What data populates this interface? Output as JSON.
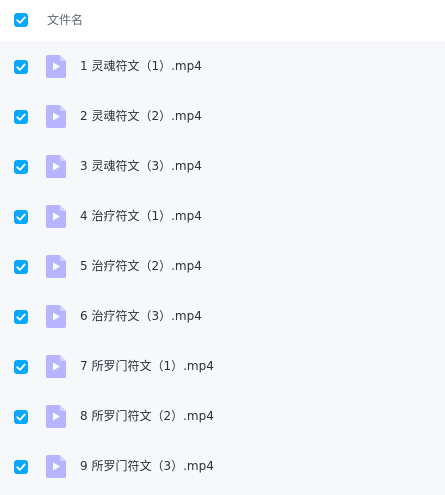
{
  "header": {
    "label": "文件名",
    "checked": true
  },
  "colors": {
    "checkbox": "#06a7ff",
    "video_icon_light": "#b8b4ff",
    "video_icon_dark": "#7c6cf5"
  },
  "files": [
    {
      "name": "1 灵魂符文（1）.mp4",
      "icon": "video-file-icon",
      "checked": true
    },
    {
      "name": "2 灵魂符文（2）.mp4",
      "icon": "video-file-icon",
      "checked": true
    },
    {
      "name": "3 灵魂符文（3）.mp4",
      "icon": "video-file-icon",
      "checked": true
    },
    {
      "name": "4 治疗符文（1）.mp4",
      "icon": "video-file-icon",
      "checked": true
    },
    {
      "name": "5 治疗符文（2）.mp4",
      "icon": "video-file-icon",
      "checked": true
    },
    {
      "name": "6 治疗符文（3）.mp4",
      "icon": "video-file-icon",
      "checked": true
    },
    {
      "name": "7 所罗门符文（1）.mp4",
      "icon": "video-file-icon",
      "checked": true
    },
    {
      "name": "8 所罗门符文（2）.mp4",
      "icon": "video-file-icon",
      "checked": true
    },
    {
      "name": "9 所罗门符文（3）.mp4",
      "icon": "video-file-icon",
      "checked": true
    }
  ]
}
